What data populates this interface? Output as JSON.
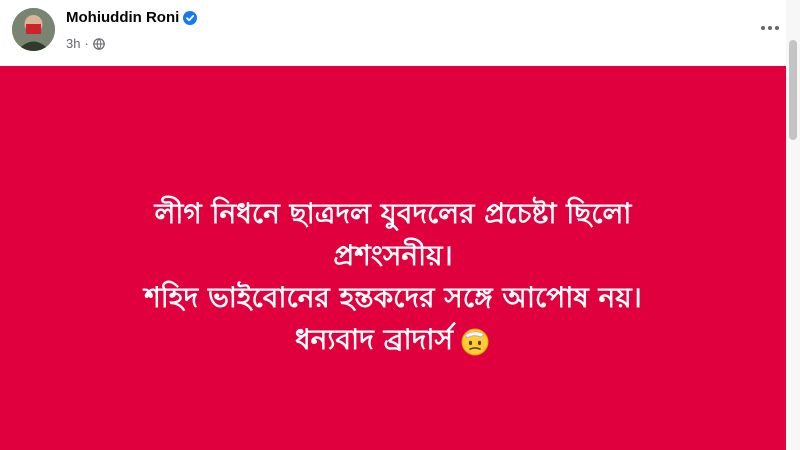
{
  "post": {
    "author": {
      "name": "Mohiuddin Roni",
      "verified": true,
      "avatar_icon": "profile-avatar"
    },
    "time": "3h",
    "separator": "·",
    "audience_icon": "globe-icon",
    "more_icon": "more-options-icon",
    "background_color": "#e1003e",
    "text_lines": [
      "লীগ নিধনে ছাত্রদল যুবদলের প্রচেষ্টা ছিলো",
      "প্রশংসনীয়।",
      "শহিদ ভাইবোনের হন্তকদের সঙ্গে আপোষ নয়।",
      "ধন্যবাদ ব্রাদার্স"
    ],
    "emoji_icon": "face-with-hand-over-eyes-salute-emoji"
  }
}
